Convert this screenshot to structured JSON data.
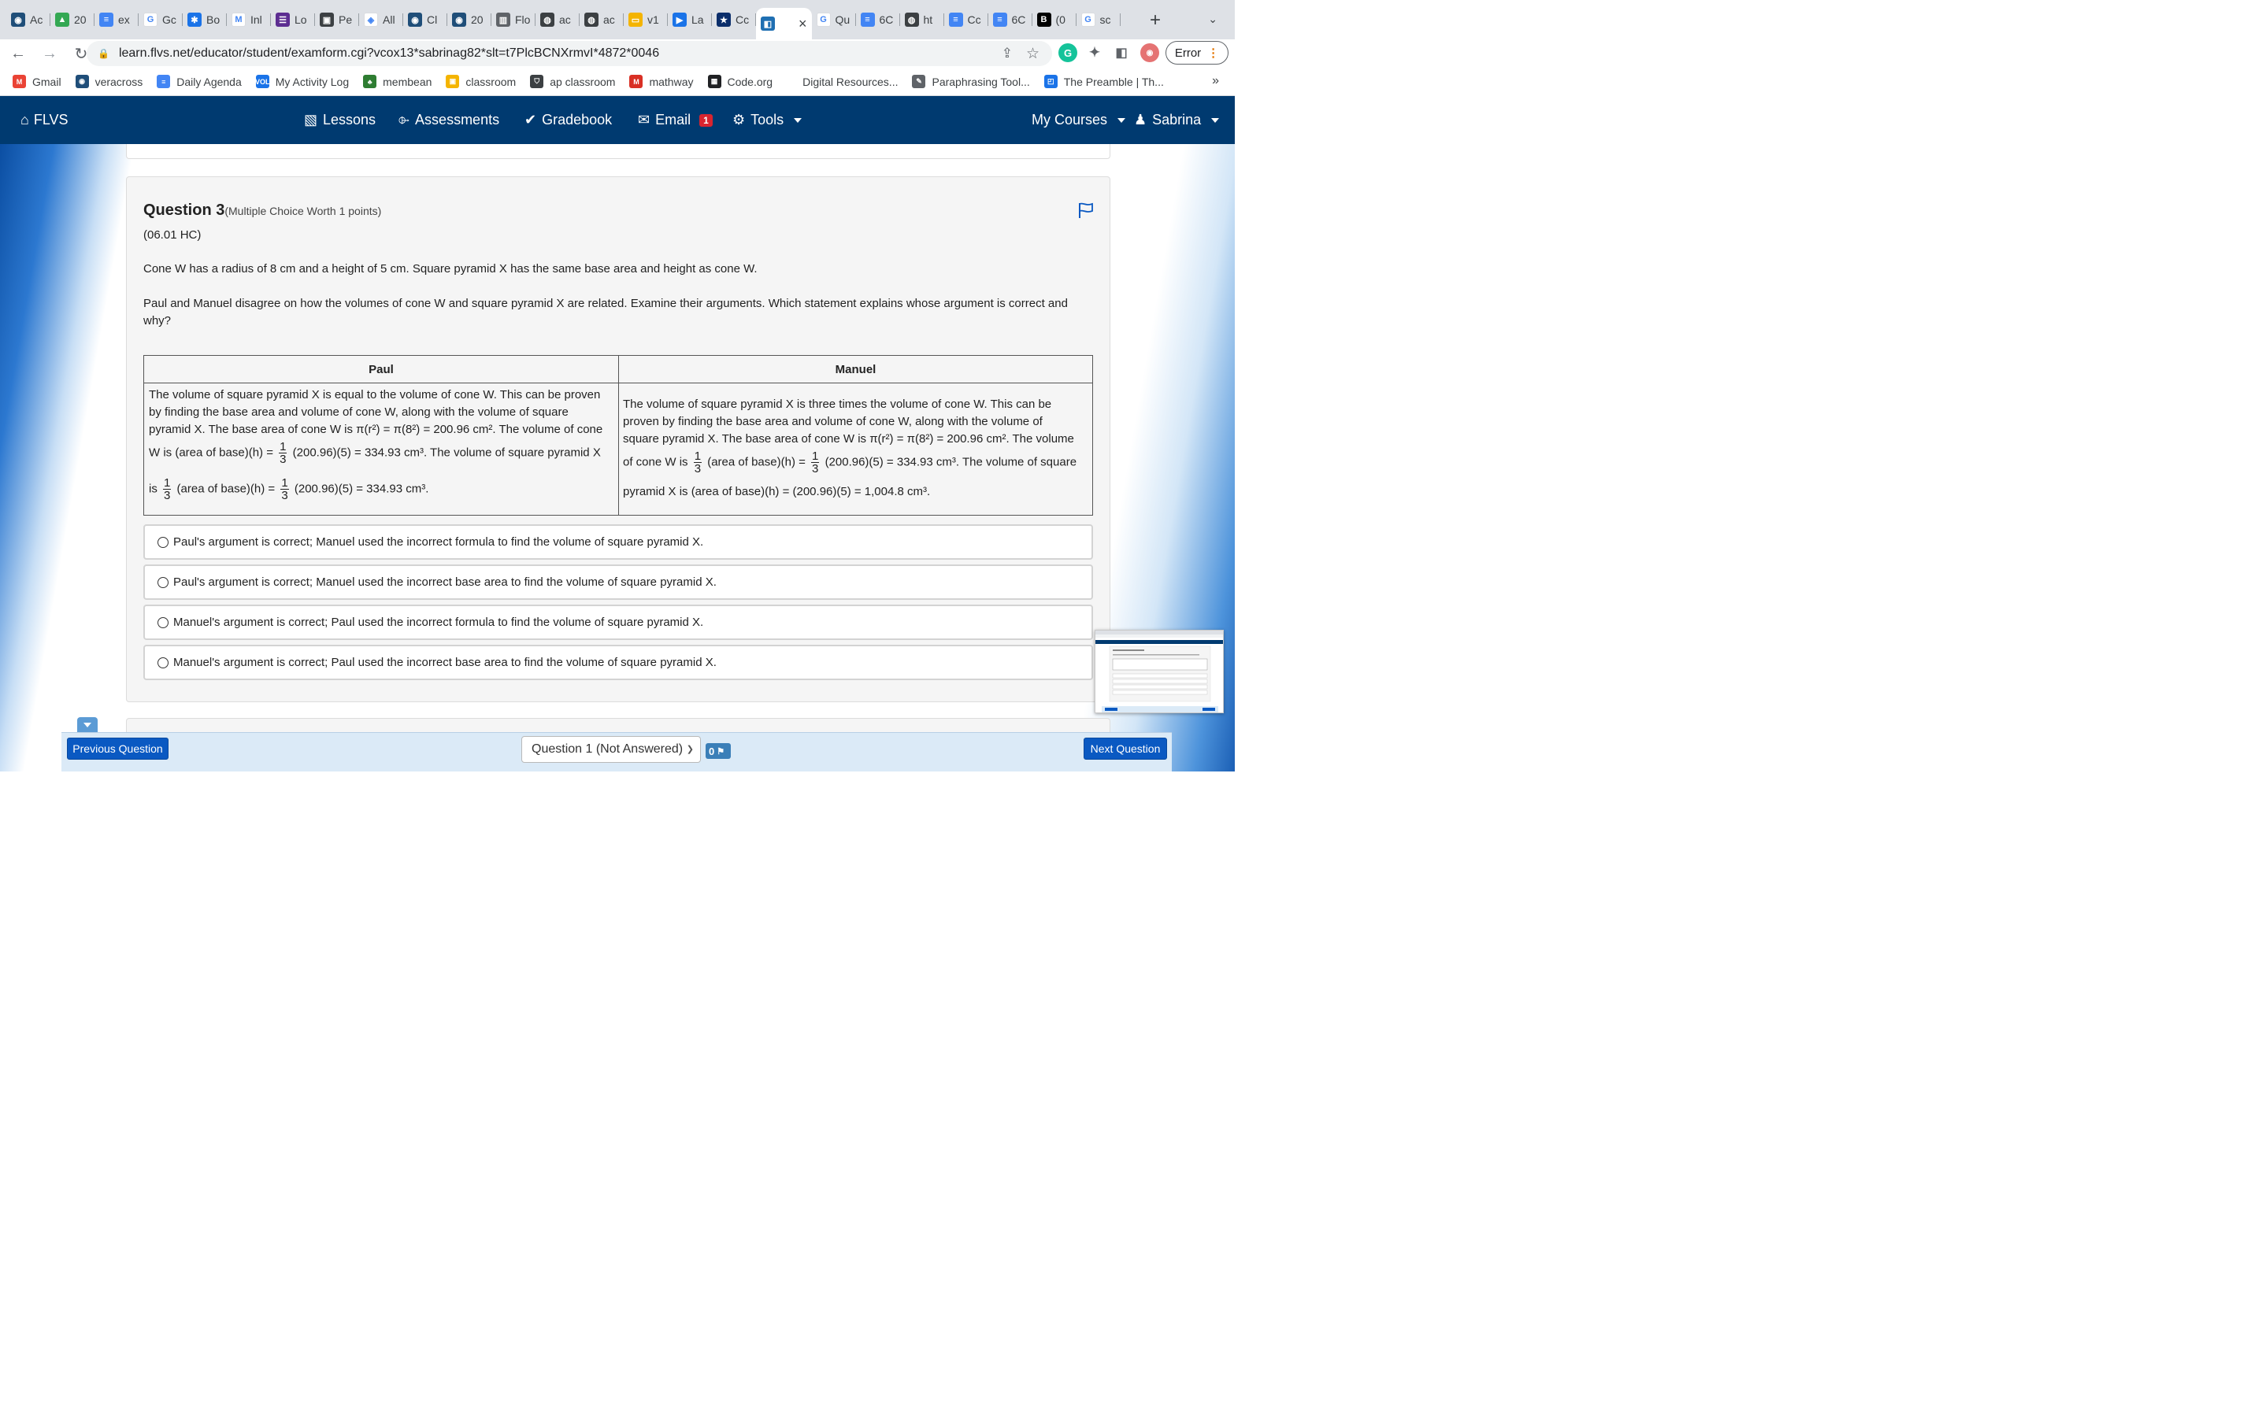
{
  "browser": {
    "tabs": [
      {
        "label": "Ac",
        "color": "#1f4e79",
        "glyph": "◉"
      },
      {
        "label": "20",
        "color": "#34a853",
        "glyph": "▲"
      },
      {
        "label": "ex",
        "color": "#4285f4",
        "glyph": "≡"
      },
      {
        "label": "Gc",
        "color": "#ffffff",
        "glyph": "G"
      },
      {
        "label": "Bo",
        "color": "#1a73e8",
        "glyph": "✱"
      },
      {
        "label": "Inl",
        "color": "#ffffff",
        "glyph": "M"
      },
      {
        "label": "Lo",
        "color": "#5c2d91",
        "glyph": "☰"
      },
      {
        "label": "Pe",
        "color": "#3c4043",
        "glyph": "▣"
      },
      {
        "label": "All",
        "color": "#ffffff",
        "glyph": "◈"
      },
      {
        "label": "Cl",
        "color": "#1f4e79",
        "glyph": "◉"
      },
      {
        "label": "20",
        "color": "#1f4e79",
        "glyph": "◉"
      },
      {
        "label": "Flo",
        "color": "#5f6368",
        "glyph": "▥"
      },
      {
        "label": "ac",
        "color": "#3c4043",
        "glyph": "◍"
      },
      {
        "label": "ac",
        "color": "#3c4043",
        "glyph": "◍"
      },
      {
        "label": "v1",
        "color": "#f4b400",
        "glyph": "▭"
      },
      {
        "label": "La",
        "color": "#1a73e8",
        "glyph": "▶"
      },
      {
        "label": "Cc",
        "color": "#0b2e6b",
        "glyph": "★"
      },
      {
        "label": "",
        "color": "#1f6fb2",
        "glyph": "◧",
        "active": true
      },
      {
        "label": "Qu",
        "color": "#ffffff",
        "glyph": "G"
      },
      {
        "label": "6C",
        "color": "#4285f4",
        "glyph": "≡"
      },
      {
        "label": "ht",
        "color": "#3c4043",
        "glyph": "◍"
      },
      {
        "label": "Cc",
        "color": "#4285f4",
        "glyph": "≡"
      },
      {
        "label": "6C",
        "color": "#4285f4",
        "glyph": "≡"
      },
      {
        "label": "(0",
        "color": "#000000",
        "glyph": "B"
      },
      {
        "label": "sc",
        "color": "#ffffff",
        "glyph": "G"
      }
    ],
    "new_tab_label": "+",
    "url": "learn.flvs.net/educator/student/examform.cgi?vcox13*sabrinag82*slt=t7PlcBCNXrmvI*4872*0046",
    "error_label": "Error",
    "bookmarks": [
      {
        "label": "Gmail",
        "color": "#ea4335",
        "glyph": "M"
      },
      {
        "label": "veracross",
        "color": "#1f4e79",
        "glyph": "◉"
      },
      {
        "label": "Daily Agenda",
        "color": "#4285f4",
        "glyph": "≡"
      },
      {
        "label": "My Activity Log",
        "color": "#1a73e8",
        "glyph": "VOL"
      },
      {
        "label": "membean",
        "color": "#2e7d32",
        "glyph": "♣"
      },
      {
        "label": "classroom",
        "color": "#f4b400",
        "glyph": "▣"
      },
      {
        "label": "ap classroom",
        "color": "#3c4043",
        "glyph": "⛉"
      },
      {
        "label": "mathway",
        "color": "#d93025",
        "glyph": "M"
      },
      {
        "label": "Code.org",
        "color": "#202124",
        "glyph": "▦"
      },
      {
        "label": "Digital Resources...",
        "color": "",
        "glyph": ""
      },
      {
        "label": "Paraphrasing Tool...",
        "color": "#5f6368",
        "glyph": "✎"
      },
      {
        "label": "The Preamble | Th...",
        "color": "#1a73e8",
        "glyph": "◰"
      }
    ],
    "bookmarks_more": "»"
  },
  "flvs_nav": {
    "brand": "FLVS",
    "lessons": "Lessons",
    "assessments": "Assessments",
    "gradebook": "Gradebook",
    "email": "Email",
    "email_count": "1",
    "tools": "Tools",
    "my_courses": "My Courses",
    "user": "Sabrina"
  },
  "question": {
    "title": "Question 3",
    "worth": "(Multiple Choice Worth 1 points)",
    "code": "(06.01 HC)",
    "prompt1": "Cone W has a radius of 8 cm and a height of 5 cm. Square pyramid X has the same base area and height as cone W.",
    "prompt2": "Paul and Manuel disagree on how the volumes of cone W and square pyramid X are related. Examine their arguments. Which statement explains whose argument is correct and why?"
  },
  "arguments": {
    "paul_header": "Paul",
    "manuel_header": "Manuel",
    "paul_l1": "The volume of square pyramid X is equal to the volume of cone W. This can be proven",
    "paul_l2": "by finding the base area and volume of cone W, along with the volume of square",
    "paul_l3": "pyramid X. The base area of cone W is π(r²) = π(8²) = 200.96 cm². The volume of cone",
    "paul_l4a": "W is (area of base)(h) =",
    "paul_l4b": "(200.96)(5) = 334.93 cm³. The volume of square pyramid X",
    "paul_l5a": "is",
    "paul_l5b": "(area of base)(h) =",
    "paul_l5c": "(200.96)(5) = 334.93 cm³.",
    "manuel_l1": "The volume of square pyramid X is three times the volume of cone W. This can be",
    "manuel_l2": "proven by finding the base area and volume of cone W, along with the volume of",
    "manuel_l3": "square pyramid X. The base area of cone W is π(r²) = π(8²) = 200.96 cm². The volume",
    "manuel_l4a": "of cone W is",
    "manuel_l4b": "(area of base)(h) =",
    "manuel_l4c": "(200.96)(5) = 334.93 cm³. The volume of square",
    "manuel_l5": "pyramid X is (area of base)(h) = (200.96)(5) = 1,004.8 cm³.",
    "frac_num": "1",
    "frac_den": "3"
  },
  "choices": [
    "Paul's argument is correct; Manuel used the incorrect formula to find the volume of square pyramid X.",
    "Paul's argument is correct; Manuel used the incorrect base area to find the volume of square pyramid X.",
    "Manuel's argument is correct; Paul used the incorrect formula to find the volume of square pyramid X.",
    "Manuel's argument is correct; Paul used the incorrect base area to find the volume of square pyramid X."
  ],
  "footer": {
    "prev": "Previous Question",
    "next": "Next Question",
    "selector": "Question 1 (Not Answered)",
    "flag_count": "0"
  }
}
